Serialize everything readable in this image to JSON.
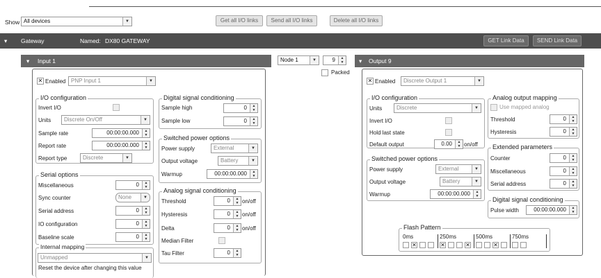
{
  "toolbar": {
    "show_label": "Show",
    "show_value": "All devices",
    "get_all": "Get all I/O links",
    "send_all": "Send all I/O links",
    "delete_all": "Delete all I/O links"
  },
  "gateway": {
    "label": "Gateway",
    "named_label": "Named:",
    "name": "DX80 GATEWAY",
    "get_link": "GET Link Data",
    "send_link": "SEND Link Data"
  },
  "node": {
    "node_value": "Node 1",
    "number_value": "9",
    "packed_label": "Packed"
  },
  "input": {
    "title": "Input 1",
    "enabled_label": "Enabled",
    "enabled_value": "PNP Input 1",
    "io_config": {
      "title": "I/O configuration",
      "invert_label": "Invert I/O",
      "units_label": "Units",
      "units_value": "Discrete On/Off",
      "sample_rate_label": "Sample rate",
      "sample_rate_value": "00:00:00.000",
      "report_rate_label": "Report rate",
      "report_rate_value": "00:00:00.000",
      "report_type_label": "Report type",
      "report_type_value": "Discrete"
    },
    "digital": {
      "title": "Digital signal conditioning",
      "sample_high_label": "Sample high",
      "sample_high_value": "0",
      "sample_low_label": "Sample low",
      "sample_low_value": "0"
    },
    "switched": {
      "title": "Switched power options",
      "supply_label": "Power supply",
      "supply_value": "External",
      "voltage_label": "Output voltage",
      "voltage_value": "Battery",
      "warmup_label": "Warmup",
      "warmup_value": "00:00:00.000"
    },
    "serial": {
      "title": "Serial options",
      "misc_label": "Miscellaneous",
      "misc_value": "0",
      "sync_label": "Sync counter",
      "sync_value": "None",
      "address_label": "Serial address",
      "address_value": "0",
      "ioconf_label": "IO configuration",
      "ioconf_value": "0",
      "baseline_label": "Baseline scale",
      "baseline_value": "0"
    },
    "analog": {
      "title": "Analog signal conditioning",
      "threshold_label": "Threshold",
      "threshold_value": "0",
      "hysteresis_label": "Hysteresis",
      "hysteresis_value": "0",
      "delta_label": "Delta",
      "delta_value": "0",
      "median_label": "Median Filter",
      "tau_label": "Tau Filter",
      "tau_value": "0",
      "onoff": "on/off"
    },
    "internal": {
      "title": "Internal mapping",
      "value": "Unmapped",
      "note": "Reset the device after changing this value"
    }
  },
  "output": {
    "title": "Output 9",
    "enabled_label": "Enabled",
    "enabled_value": "Discrete Output 1",
    "io_config": {
      "title": "I/O configuration",
      "units_label": "Units",
      "units_value": "Discrete",
      "invert_label": "Invert I/O",
      "hold_label": "Hold last state",
      "default_label": "Default output",
      "default_value": "0.00",
      "onoff": "on/off"
    },
    "analog_map": {
      "title": "Analog output mapping",
      "use_mapped_label": "Use mapped analog",
      "threshold_label": "Threshold",
      "threshold_value": "0",
      "hysteresis_label": "Hysteresis",
      "hysteresis_value": "0"
    },
    "switched": {
      "title": "Switched power options",
      "supply_label": "Power supply",
      "supply_value": "External",
      "voltage_label": "Output voltage",
      "voltage_value": "Battery",
      "warmup_label": "Warmup",
      "warmup_value": "00:00:00.000"
    },
    "extended": {
      "title": "Extended parameters",
      "counter_label": "Counter",
      "counter_value": "0",
      "misc_label": "Miscellaneous",
      "misc_value": "0",
      "address_label": "Serial address",
      "address_value": "0"
    },
    "digital": {
      "title": "Digital signal conditioning",
      "pulse_label": "Pulse width",
      "pulse_value": "00:00:00.000"
    },
    "flash": {
      "title": "Flash Pattern",
      "marks": [
        "0ms",
        "250ms",
        "500ms",
        "750ms"
      ],
      "cells": [
        false,
        true,
        false,
        false,
        true,
        false,
        false,
        true,
        false,
        false,
        true,
        false,
        false,
        false
      ]
    }
  },
  "colors": {
    "gateway_bar": "#4e4e4e",
    "section_bar": "#666666"
  }
}
